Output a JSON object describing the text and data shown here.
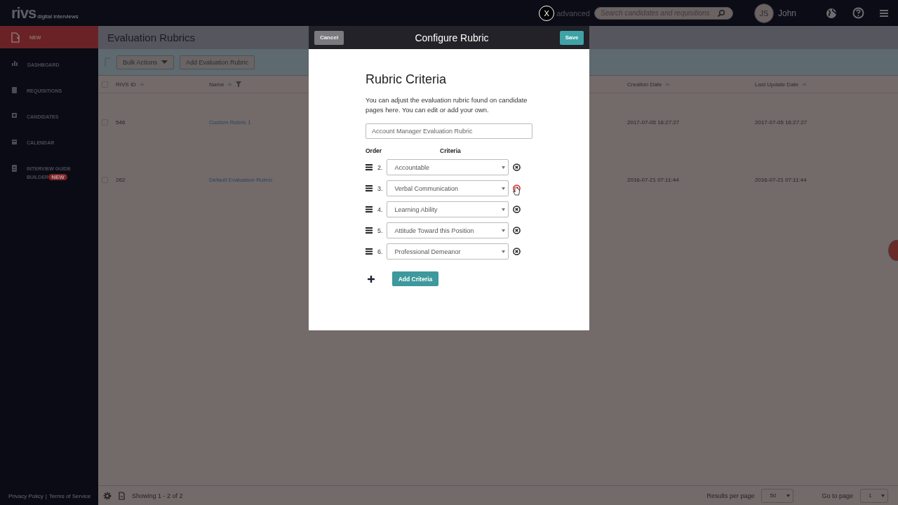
{
  "topbar": {
    "logo": "rivs",
    "logo_tagline": "digital interviews",
    "advanced_link": "advanced",
    "search": {
      "placeholder": "Search candidates and requisitions"
    },
    "avatar_initials": "JS",
    "user_name": "John"
  },
  "sidebar": {
    "new_button": "NEW",
    "items": [
      {
        "label": "DASHBOARD"
      },
      {
        "label": "REQUISITIONS"
      },
      {
        "label": "CANDIDATES"
      },
      {
        "label": "CALENDAR"
      },
      {
        "label": "INTERVIEW GUIDE BUILDER",
        "badge": "NEW"
      }
    ],
    "footer_links": [
      "Privacy Policy",
      "Terms of Service"
    ],
    "footer_separator": "|"
  },
  "page": {
    "title": "Evaluation Rubrics",
    "toolbar": {
      "bulk_actions": "Bulk Actions",
      "add_button": "Add Evaluation Rubric"
    },
    "table": {
      "select_all_checked": false,
      "columns": [
        {
          "label": "RIVS ID",
          "filter": false
        },
        {
          "label": "Name",
          "filter": true
        },
        {
          "label": "Creation Date",
          "filter": false
        },
        {
          "label": "Last Update Date",
          "filter": false
        }
      ],
      "rows": [
        {
          "checked": false,
          "cells": [
            "546",
            "Custom Rubric 1",
            "2017-07-05 16:27:27",
            "2017-07-05 16:27:27"
          ]
        },
        {
          "checked": false,
          "cells": [
            "262",
            "Default Evaluation Rubric",
            "2016-07-21 07:11:44",
            "2016-07-21 07:11:44"
          ]
        }
      ]
    },
    "footer": {
      "showing": "Showing 1 - 2 of 2",
      "results_label": "Results per page",
      "results_value": "50",
      "goto_label": "Go to page",
      "goto_value": "1"
    }
  },
  "modal": {
    "title": "Configure Rubric",
    "cancel": "Cancel",
    "save": "Save",
    "heading": "Rubric Criteria",
    "description": "You can adjust the evaluation rubric found on candidate pages here. You can edit or add your own.",
    "name_value": "Account Manager Evaluation Rubric",
    "order_header": "Order",
    "criteria_header": "Criteria",
    "criteria": [
      {
        "order": "2.",
        "value": "Accountable",
        "hovered": false
      },
      {
        "order": "3.",
        "value": "Verbal Communication",
        "hovered": true
      },
      {
        "order": "4.",
        "value": "Learning Ability",
        "hovered": false
      },
      {
        "order": "5.",
        "value": "Attitude Toward this Position",
        "hovered": false
      },
      {
        "order": "6.",
        "value": "Professional Demeanor",
        "hovered": false
      }
    ],
    "add_button": "Add Criteria"
  },
  "dismiss_button": "X"
}
